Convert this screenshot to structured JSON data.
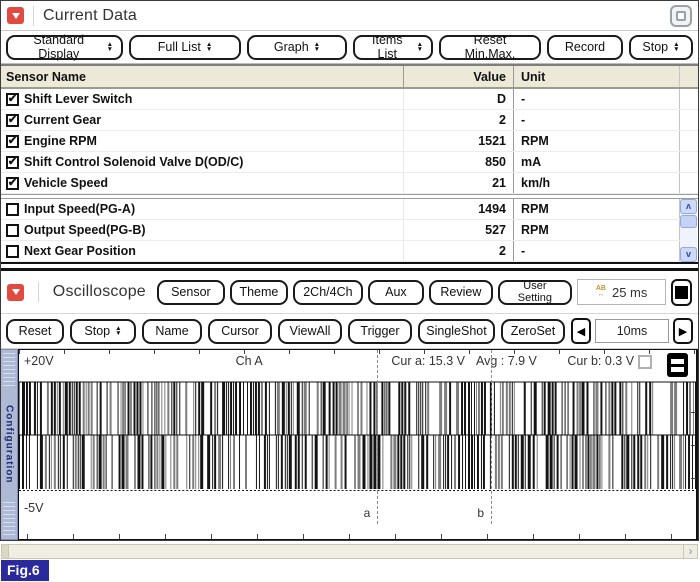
{
  "figure_label": "Fig.6",
  "colors": {
    "accent_red": "#e04a40",
    "table_header": "#ece9d8",
    "figure_bg": "#2a2a9c",
    "scrollbar_blue": "#cdd9f7"
  },
  "current_data": {
    "title": "Current Data",
    "toolbar": [
      {
        "label": "Standard Display",
        "spinner": true
      },
      {
        "label": "Full List",
        "spinner": true
      },
      {
        "label": "Graph",
        "spinner": true
      },
      {
        "label": "Items List",
        "spinner": true
      },
      {
        "label": "Reset Min.Max.",
        "spinner": false
      },
      {
        "label": "Record",
        "spinner": false
      },
      {
        "label": "Stop",
        "spinner": true
      }
    ],
    "table": {
      "headers": [
        "Sensor Name",
        "Value",
        "Unit"
      ],
      "rows": [
        {
          "name": "Shift Lever Switch",
          "value": "D",
          "unit": "-",
          "check": "✔"
        },
        {
          "name": "Current Gear",
          "value": "2",
          "unit": "-",
          "check": "✔"
        },
        {
          "name": "Engine RPM",
          "value": "1521",
          "unit": "RPM",
          "check": "✔"
        },
        {
          "name": "Shift Control Solenoid Valve D(OD/C)",
          "value": "850",
          "unit": "mA",
          "check": "✔"
        },
        {
          "name": "Vehicle Speed",
          "value": "21",
          "unit": "km/h",
          "check": "✔"
        },
        {
          "name": "Input Speed(PG-A)",
          "value": "1494",
          "unit": "RPM",
          "check": ""
        },
        {
          "name": "Output Speed(PG-B)",
          "value": "527",
          "unit": "RPM",
          "check": ""
        },
        {
          "name": "Next Gear Position",
          "value": "2",
          "unit": "-",
          "check": ""
        }
      ]
    }
  },
  "oscilloscope": {
    "title": "Oscilloscope",
    "toolbar1": [
      "Sensor",
      "Theme",
      "2Ch/4Ch",
      "Aux",
      "Review",
      "User Setting"
    ],
    "sample_display": "25 ms",
    "sample_icon": "AB",
    "toolbar2": [
      {
        "label": "Reset",
        "spinner": false
      },
      {
        "label": "Stop",
        "spinner": true
      },
      {
        "label": "Name",
        "spinner": false
      },
      {
        "label": "Cursor",
        "spinner": false
      },
      {
        "label": "ViewAll",
        "spinner": false
      },
      {
        "label": "Trigger",
        "spinner": false
      },
      {
        "label": "SingleShot",
        "spinner": false
      },
      {
        "label": "ZeroSet",
        "spinner": false
      }
    ],
    "timebase": "10ms",
    "prev_arrow": "◀",
    "next_arrow": "▶",
    "scope": {
      "v_top": "+20V",
      "v_bottom": "-5V",
      "channel": "Ch A",
      "cur_a": "Cur a: 15.3 V",
      "avg": "Avg : 7.9 V",
      "cur_b": "Cur b: 0.3 V",
      "cursor_a_label": "a",
      "cursor_b_label": "b",
      "cursor_a_pos_pct": 52.9,
      "cursor_b_pos_pct": 69.7,
      "side_tab": "Configuration"
    }
  },
  "bottom_scrollbar": {
    "right_arrow": "›"
  }
}
